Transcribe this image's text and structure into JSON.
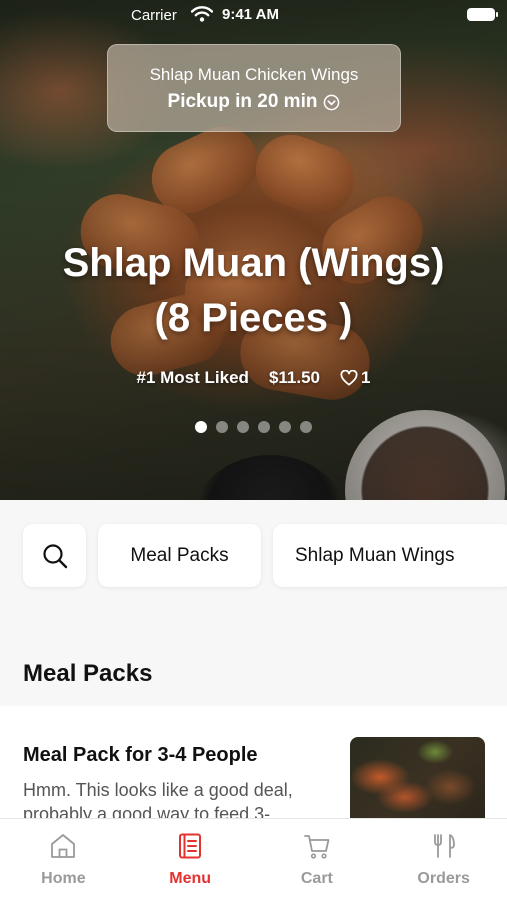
{
  "status_bar": {
    "carrier": "Carrier",
    "time": "9:41 AM"
  },
  "pickup": {
    "store": "Shlap Muan Chicken Wings",
    "eta": "Pickup in 20 min"
  },
  "hero": {
    "title_line1": "Shlap Muan (Wings)",
    "title_line2": "(8 Pieces )",
    "rank": "#1 Most Liked",
    "price": "$11.50",
    "likes": "1",
    "carousel_total": 6,
    "carousel_active": 1
  },
  "categories": {
    "search_icon": "search-icon",
    "items": [
      "Meal Packs",
      "Shlap Muan Wings"
    ]
  },
  "section": {
    "title": "Meal Packs"
  },
  "item": {
    "name": "Meal Pack for 3-4 People",
    "description": "Hmm. This looks like a good deal, probably a good way to feed 3-..."
  },
  "tabs": [
    {
      "label": "Home",
      "icon": "home-icon",
      "active": false
    },
    {
      "label": "Menu",
      "icon": "menu-icon",
      "active": true
    },
    {
      "label": "Cart",
      "icon": "cart-icon",
      "active": false
    },
    {
      "label": "Orders",
      "icon": "orders-icon",
      "active": false
    }
  ],
  "colors": {
    "accent": "#e5322f",
    "inactive": "#9a9a9a"
  }
}
